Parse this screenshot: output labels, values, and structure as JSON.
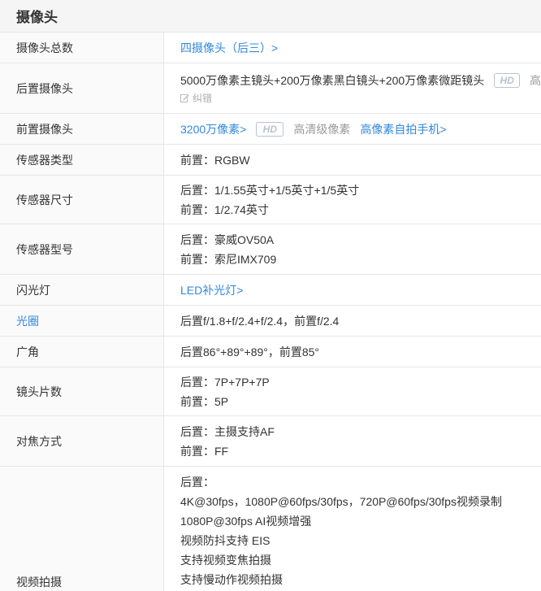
{
  "header": {
    "title": "摄像头"
  },
  "rows": {
    "total": {
      "label": "摄像头总数",
      "value": "四摄像头（后三）>"
    },
    "rear": {
      "label": "后置摄像头",
      "value": "5000万像素主镜头+200万像素黑白镜头+200万像素微距镜头",
      "hd": "HD",
      "hd_trailing": "高",
      "correct": "纠错"
    },
    "front": {
      "label": "前置摄像头",
      "value": "3200万像素>",
      "hd": "HD",
      "hd_desc": "高清级像素",
      "selfie": "高像素自拍手机>"
    },
    "sensor_type": {
      "label": "传感器类型",
      "lines": [
        "前置：RGBW"
      ]
    },
    "sensor_size": {
      "label": "传感器尺寸",
      "lines": [
        "后置：1/1.55英寸+1/5英寸+1/5英寸",
        "前置：1/2.74英寸"
      ]
    },
    "sensor_model": {
      "label": "传感器型号",
      "lines": [
        "后置：豪威OV50A",
        "前置：索尼IMX709"
      ]
    },
    "flash": {
      "label": "闪光灯",
      "value": "LED补光灯>"
    },
    "aperture": {
      "label": "光圈",
      "lines": [
        "后置f/1.8+f/2.4+f/2.4，前置f/2.4"
      ]
    },
    "wide_angle": {
      "label": "广角",
      "lines": [
        "后置86°+89°+89°，前置85°"
      ]
    },
    "lens_count": {
      "label": "镜头片数",
      "lines": [
        "后置：7P+7P+7P",
        "前置：5P"
      ]
    },
    "focus": {
      "label": "对焦方式",
      "lines": [
        "后置：主摄支持AF",
        "前置：FF"
      ]
    },
    "video": {
      "label": "视频拍摄",
      "lines": [
        "后置：",
        "4K@30fps，1080P@60fps/30fps，720P@60fps/30fps视频录制",
        "1080P@30fps AI视频增强",
        "视频防抖支持 EIS",
        "支持视频变焦拍摄",
        "支持慢动作视频拍摄"
      ]
    }
  },
  "colors": {
    "link": "#3388dd",
    "label_bg": "#fafafa",
    "border": "#e6e6e6",
    "hd_badge": "#b8c3d1"
  },
  "icons": {
    "correct": "pencil-icon"
  }
}
